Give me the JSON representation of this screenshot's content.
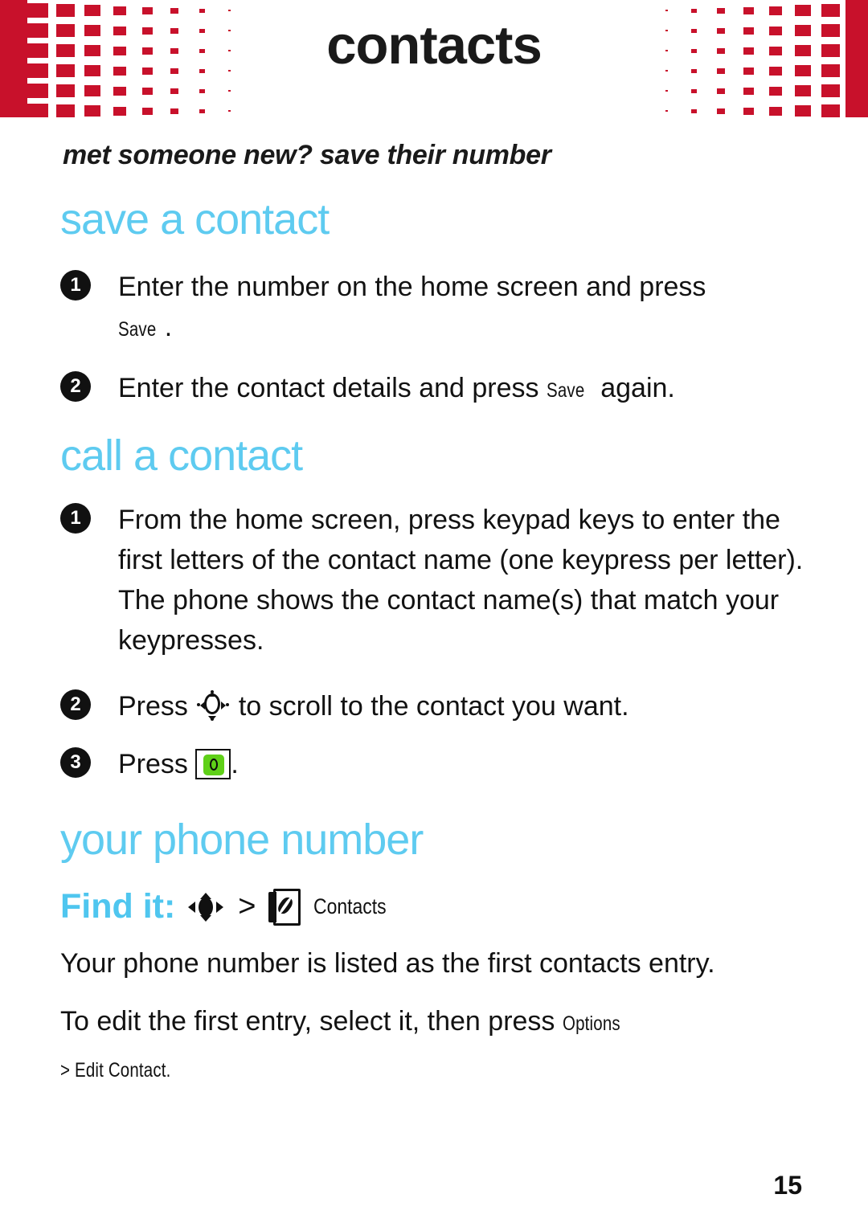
{
  "header": {
    "title": "contacts",
    "accent_color": "#c8112b"
  },
  "subtitle": "met someone new? save their number",
  "sections": [
    {
      "heading": "save a contact",
      "steps": [
        {
          "num": "1",
          "text_before": "Enter the number on the home screen and press",
          "softkey": "Save",
          "text_after": "."
        },
        {
          "num": "2",
          "text_before": "Enter the contact details and press",
          "softkey": "Save",
          "text_after": "again."
        }
      ]
    },
    {
      "heading": "call a contact",
      "steps": [
        {
          "num": "1",
          "text": "From the home screen, press keypad keys to enter the first letters of the contact name (one keypress per letter). The phone shows the contact name(s) that match your keypresses."
        },
        {
          "num": "2",
          "text_before": "Press",
          "icon": "navigation-key-icon",
          "text_after": "to scroll to the contact you want."
        },
        {
          "num": "3",
          "text_before": "Press",
          "icon": "send-key-icon",
          "text_after": "."
        }
      ]
    },
    {
      "heading": "your phone number",
      "find_it": {
        "label": "Find it:",
        "nav_icon": "navigation-key-filled-icon",
        "separator": ">",
        "menu_icon": "contacts-book-icon",
        "menu_label": "Contacts"
      },
      "paragraphs": [
        "Your phone number is listed as the first contacts entry.",
        "To edit the first entry, select it, then press"
      ],
      "options_softkey": "Options",
      "submenu": "> Edit Contact."
    }
  ],
  "page_number": "15",
  "colors": {
    "heading_cyan": "#5ecbf0",
    "header_red": "#c8112b",
    "send_key_green": "#5fd018"
  }
}
